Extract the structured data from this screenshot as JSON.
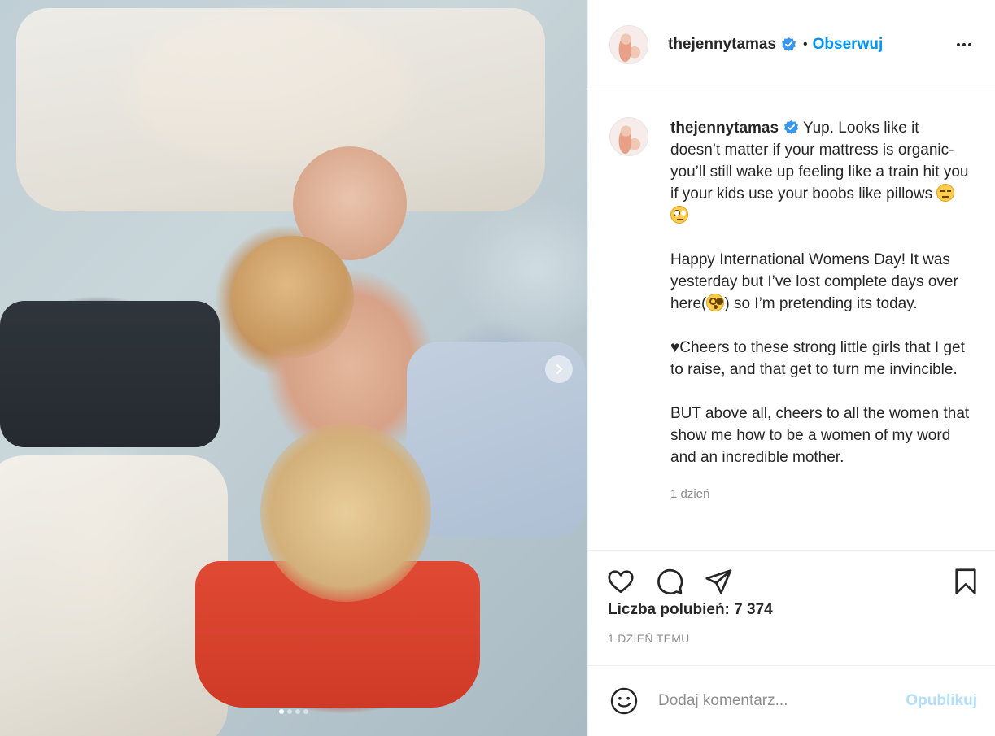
{
  "post": {
    "username": "thejennytamas",
    "follow_label": "Obserwuj",
    "separator": "•",
    "carousel": {
      "slide_count": 4,
      "active_index": 0
    }
  },
  "caption": {
    "lines": [
      "Yup. Looks like it doesn’t matter if your mattress is organic- you’ll still wake up feeling like a train hit you if your kids use your boobs like pillows",
      "Happy International Womens Day! It was yesterday but I’ve lost complete days over here(",
      ") so I’m pretending its today.",
      "♥Cheers to these strong little girls that I get to raise, and that get to turn me invincible.",
      "BUT above all, cheers to all the women that show me how to be a women of my word and an incredible mother."
    ],
    "time_ago": "1 dzień"
  },
  "actions": {
    "likes_text": "Liczba polubień: 7 374",
    "date_text": "1 dzień temu"
  },
  "comment": {
    "placeholder": "Dodaj komentarz...",
    "publish_label": "Opublikuj"
  },
  "icons": [
    "verified-badge-icon",
    "more-options-icon",
    "heart-icon",
    "comment-icon",
    "share-icon",
    "bookmark-icon",
    "emoji-icon",
    "next-arrow-icon"
  ],
  "colors": {
    "accent": "#0095f6",
    "publish_disabled": "#b2dffc",
    "muted": "#8e8e8e",
    "text": "#262626"
  }
}
